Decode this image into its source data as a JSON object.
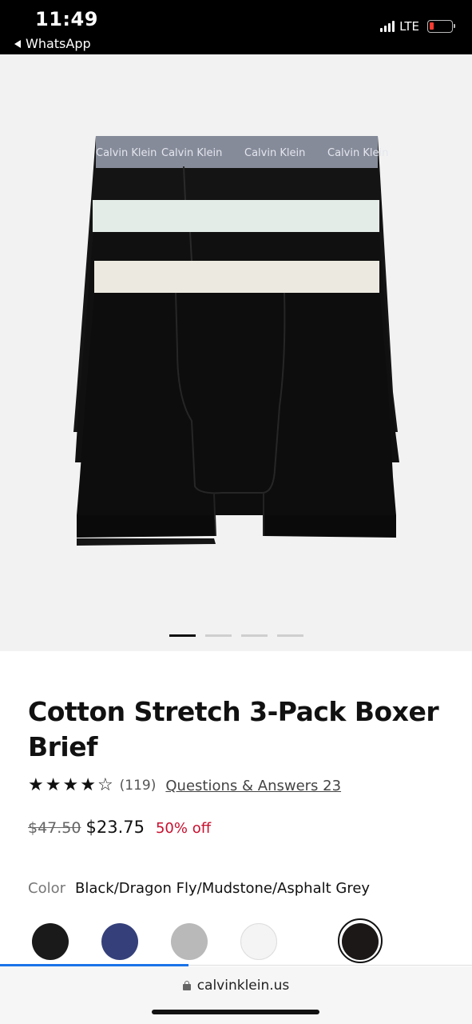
{
  "status_bar": {
    "time": "11:49",
    "back_app": "WhatsApp",
    "network": "LTE",
    "battery_color": "#ff3b30"
  },
  "hero": {
    "waistband_text": "Calvin Klein",
    "carousel_total": 4,
    "carousel_active": 1
  },
  "product": {
    "title": "Cotton Stretch 3-Pack Boxer Brief",
    "rating": 4,
    "rating_max": 5,
    "review_count": "(119)",
    "qa_link": "Questions & Answers 23",
    "price_original": "$47.50",
    "price_sale": "$23.75",
    "discount": "50% off",
    "color_label": "Color",
    "color_value": "Black/Dragon Fly/Mudstone/Asphalt Grey",
    "swatches": [
      {
        "name": "Black",
        "color": "#1a1a1a"
      },
      {
        "name": "Navy",
        "color": "#35407a"
      },
      {
        "name": "Heather Grey",
        "color": "#b9b9b9"
      },
      {
        "name": "White",
        "color": "#f4f4f4"
      },
      {
        "name": "Black/Dragon Fly/Mudstone/Asphalt Grey",
        "color": "#1c1818",
        "selected": true
      }
    ]
  },
  "browser": {
    "url": "calvinklein.us",
    "load_progress": 0.4
  }
}
